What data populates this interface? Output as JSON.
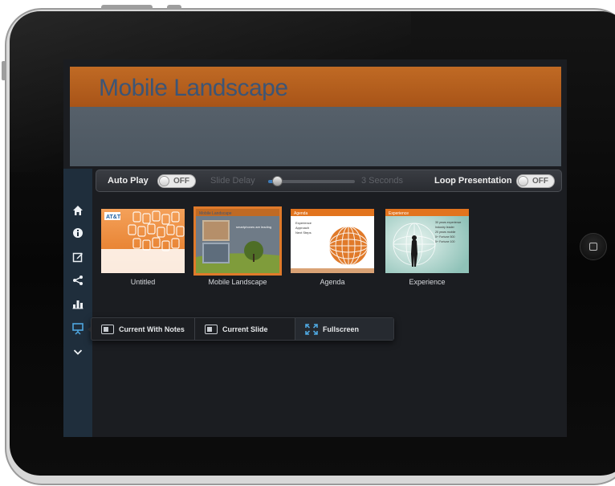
{
  "slide": {
    "title": "Mobile Landscape"
  },
  "controls": {
    "auto_play_label": "Auto Play",
    "auto_play_state": "OFF",
    "slide_delay_label": "Slide Delay",
    "slide_delay_value": "3 Seconds",
    "slide_delay_level": 0.1,
    "loop_label": "Loop Presentation",
    "loop_state": "OFF"
  },
  "sidebar": {
    "items": [
      {
        "icon": "home-icon"
      },
      {
        "icon": "info-icon"
      },
      {
        "icon": "edit-icon"
      },
      {
        "icon": "share-icon"
      },
      {
        "icon": "chart-icon"
      },
      {
        "icon": "presentation-icon",
        "active": true
      },
      {
        "icon": "chevron-down-icon"
      }
    ]
  },
  "thumbnails": [
    {
      "label": "Untitled"
    },
    {
      "label": "Mobile Landscape",
      "selected": true
    },
    {
      "label": "Agenda",
      "header": "Agenda",
      "bullets": [
        "Experience",
        "Approach",
        "Next Steps"
      ]
    },
    {
      "label": "Experience",
      "header": "Experience",
      "bullets": [
        "30 years experience",
        "Industry leader",
        "20 years mobile",
        "5+ Fortune 500",
        "5+ Fortune 100"
      ]
    }
  ],
  "thumb_mobile": {
    "header": "Mobile Landscape",
    "caption": "smartphones are leading"
  },
  "thumb_untitled": {
    "logo": "AT&T"
  },
  "menu": {
    "items": [
      {
        "label": "Current With Notes"
      },
      {
        "label": "Current Slide"
      },
      {
        "label": "Fullscreen"
      }
    ]
  },
  "colors": {
    "accent_orange": "#c06a24",
    "title_blue": "#3c5576",
    "sidebar_active": "#4fa7e0"
  }
}
